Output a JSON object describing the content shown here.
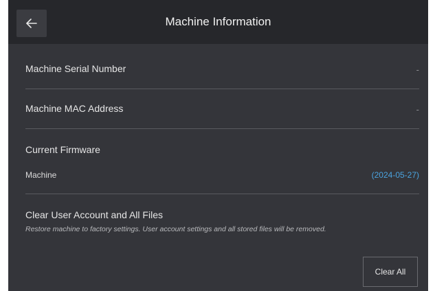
{
  "header": {
    "title": "Machine Information",
    "back_icon": "arrow-left-icon"
  },
  "rows": {
    "serial": {
      "label": "Machine Serial Number",
      "value": "-"
    },
    "mac": {
      "label": "Machine MAC Address",
      "value": "-"
    },
    "firmware": {
      "label": "Current Firmware",
      "machine_label": "Machine",
      "machine_value": "(2024-05-27)"
    },
    "reset": {
      "label": "Clear User Account and All Files",
      "description": "Restore machine to factory settings. User account settings and all stored files will be removed.",
      "button_label": "Clear All"
    }
  },
  "colors": {
    "background": "#34353a",
    "header": "#26272b",
    "accent": "#4aa3df"
  }
}
